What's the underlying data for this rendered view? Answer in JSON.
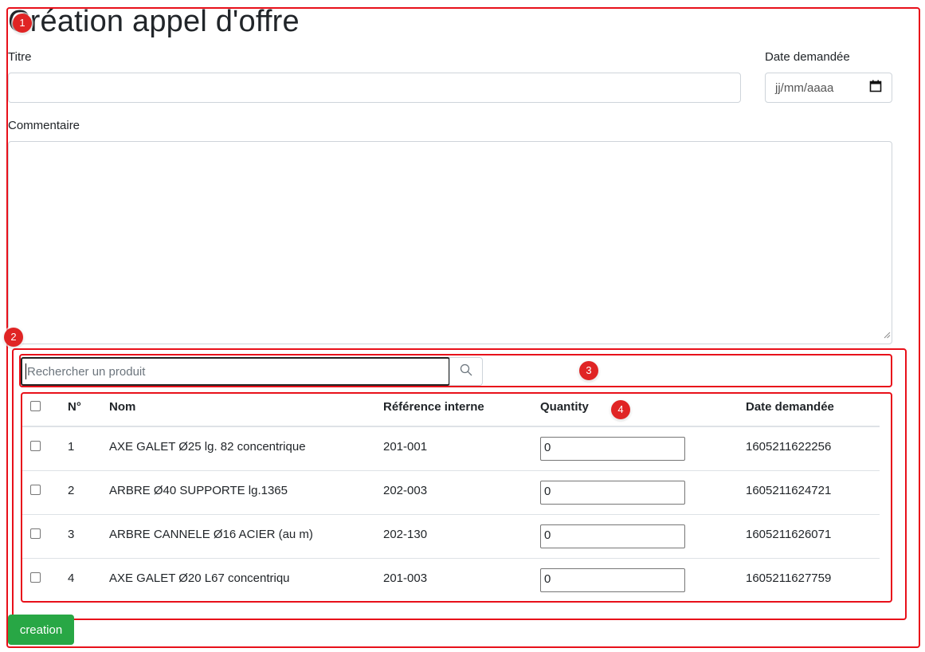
{
  "page": {
    "title": "Création appel d'offre"
  },
  "form": {
    "titre_label": "Titre",
    "titre_value": "",
    "date_label": "Date demandée",
    "date_placeholder": "jj/mm/aaaa",
    "commentaire_label": "Commentaire",
    "commentaire_value": ""
  },
  "search": {
    "placeholder": "Rechercher un produit"
  },
  "table": {
    "headers": [
      "N°",
      "Nom",
      "Référence interne",
      "Quantity",
      "Date demandée"
    ],
    "rows": [
      {
        "n": "1",
        "nom": "AXE GALET Ø25 lg. 82 concentrique",
        "ref": "201-001",
        "qty": "0",
        "date": "1605211622256"
      },
      {
        "n": "2",
        "nom": "ARBRE Ø40 SUPPORTE lg.1365",
        "ref": "202-003",
        "qty": "0",
        "date": "1605211624721"
      },
      {
        "n": "3",
        "nom": "ARBRE CANNELE Ø16 ACIER (au m)",
        "ref": "202-130",
        "qty": "0",
        "date": "1605211626071"
      },
      {
        "n": "4",
        "nom": "AXE GALET Ø20 L67 concentriqu",
        "ref": "201-003",
        "qty": "0",
        "date": "1605211627759"
      }
    ]
  },
  "actions": {
    "create_label": "creation"
  },
  "markers": [
    "1",
    "2",
    "3",
    "4"
  ],
  "colors": {
    "annotation": "#e8101a",
    "primary_button": "#28a745"
  },
  "icons": {
    "search": "search-icon",
    "calendar": "calendar-icon"
  }
}
